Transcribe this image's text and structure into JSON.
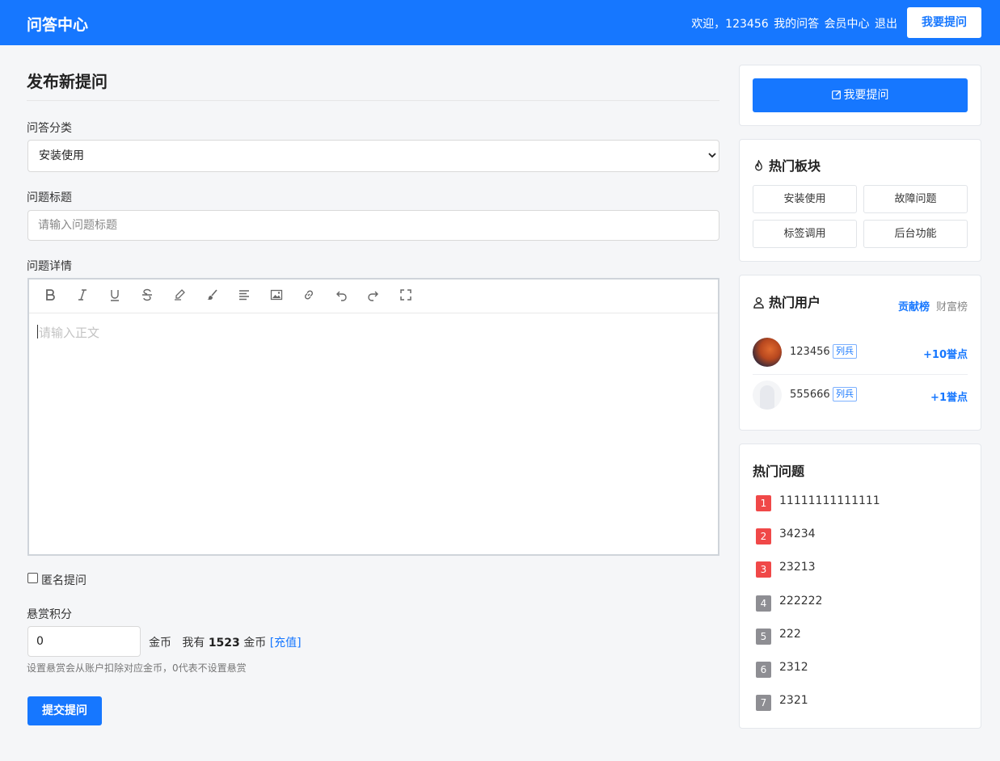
{
  "header": {
    "brand": "问答中心",
    "welcome": "欢迎，123456",
    "nav_my_questions": "我的问答",
    "nav_member_center": "会员中心",
    "nav_logout": "退出",
    "ask_button": "我要提问"
  },
  "form": {
    "page_title": "发布新提问",
    "category_label": "问答分类",
    "category_value": "安装使用",
    "title_label": "问题标题",
    "title_placeholder": "请输入问题标题",
    "detail_label": "问题详情",
    "editor_placeholder": "请输入正文",
    "toolbar": [
      "bold",
      "italic",
      "underline",
      "strikethrough",
      "highlight",
      "format-brush",
      "align",
      "image",
      "link",
      "undo",
      "redo",
      "fullscreen"
    ],
    "anonymous_label": "匿名提问",
    "anonymous_checked": false,
    "bounty_label": "悬赏积分",
    "bounty_value": "0",
    "bounty_unit": "金币",
    "balance_prefix": "我有",
    "balance_amount": "1523",
    "balance_unit": "金币",
    "recharge_link": "[充值]",
    "bounty_hint": "设置悬赏会从账户扣除对应金币，0代表不设置悬赏",
    "submit_button": "提交提问"
  },
  "sidebar": {
    "ask_button": "我要提问",
    "hot_boards": {
      "title": "热门板块",
      "items": [
        "安装使用",
        "故障问题",
        "标签调用",
        "后台功能"
      ]
    },
    "hot_users": {
      "title": "热门用户",
      "tab_active": "贡献榜",
      "tab_inactive": "财富榜",
      "users": [
        {
          "name": "123456",
          "badge": "列兵",
          "points": "+10誉点"
        },
        {
          "name": "555666",
          "badge": "列兵",
          "points": "+1誉点"
        }
      ]
    },
    "hot_questions": {
      "title": "热门问题",
      "items": [
        {
          "rank": "1",
          "title": "11111111111111",
          "color": "#f04848"
        },
        {
          "rank": "2",
          "title": "34234",
          "color": "#f04848"
        },
        {
          "rank": "3",
          "title": "23213",
          "color": "#f04848"
        },
        {
          "rank": "4",
          "title": "222222",
          "color": "#8e8e93"
        },
        {
          "rank": "5",
          "title": "222",
          "color": "#8e8e93"
        },
        {
          "rank": "6",
          "title": "2312",
          "color": "#8e8e93"
        },
        {
          "rank": "7",
          "title": "2321",
          "color": "#8e8e93"
        }
      ]
    }
  },
  "colors": {
    "primary": "#1677ff",
    "hot_rank_top": "#f04848",
    "hot_rank_other": "#8e8e93"
  }
}
